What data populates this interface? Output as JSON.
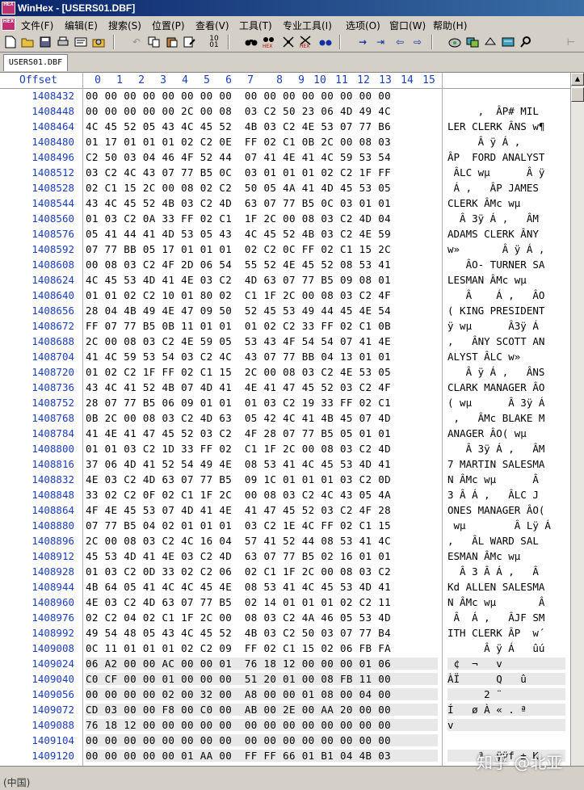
{
  "window": {
    "title": "WinHex - [USERS01.DBF]",
    "app_icon_text": "HEX"
  },
  "menu": [
    {
      "label": "文件(F)"
    },
    {
      "label": "编辑(E)"
    },
    {
      "label": "搜索(S)"
    },
    {
      "label": "位置(P)"
    },
    {
      "label": "查看(V)"
    },
    {
      "label": "工具(T)"
    },
    {
      "label": "专业工具(I)"
    },
    {
      "label": "选项(O)"
    },
    {
      "label": "窗口(W)"
    },
    {
      "label": "帮助(H)"
    }
  ],
  "toolbar": {
    "icons": [
      "new-file-icon",
      "open-folder-icon",
      "save-icon",
      "print-icon",
      "properties-icon",
      "open-disk-icon",
      "undo-icon",
      "copy-icon",
      "paste-icon",
      "write-icon",
      "clipboard-icon",
      "convert-icon",
      "binoculars-icon",
      "find-hex-icon",
      "replace-text-icon",
      "replace-hex-icon",
      "find-again-icon",
      "goto-offset-icon",
      "goto-icon",
      "back-icon",
      "forward-icon",
      "disk-icon",
      "ram-icon",
      "hash-icon",
      "calculator-icon",
      "search-tool-icon",
      "end-icon"
    ]
  },
  "tabs": [
    {
      "label": "USERS01.DBF"
    }
  ],
  "header": {
    "offset_label": "Offset",
    "columns": [
      "0",
      "1",
      "2",
      "3",
      "4",
      "5",
      "6",
      "7",
      "8",
      "9",
      "10",
      "11",
      "12",
      "13",
      "14",
      "15"
    ]
  },
  "rows": [
    {
      "offset": "1408432",
      "hex": "00 00 00 00 00 00 00 00  00 00 00 00 00 00 00 00",
      "ascii": ""
    },
    {
      "offset": "1408448",
      "hex": "00 00 00 00 00 2C 00 08  03 C2 50 23 06 4D 49 4C",
      "ascii": "     ,  ÂP# MIL"
    },
    {
      "offset": "1408464",
      "hex": "4C 45 52 05 43 4C 45 52  4B 03 C2 4E 53 07 77 B6",
      "ascii": "LER CLERK ÂNS w¶"
    },
    {
      "offset": "1408480",
      "hex": "01 17 01 01 01 02 C2 0E  FF 02 C1 0B 2C 00 08 03",
      "ascii": "     Â ÿ Á ,"
    },
    {
      "offset": "1408496",
      "hex": "C2 50 03 04 46 4F 52 44  07 41 4E 41 4C 59 53 54",
      "ascii": "ÂP  FORD ANALYST"
    },
    {
      "offset": "1408512",
      "hex": "03 C2 4C 43 07 77 B5 0C  03 01 01 01 02 C2 1F FF",
      "ascii": " ÂLC wµ      Â ÿ"
    },
    {
      "offset": "1408528",
      "hex": "02 C1 15 2C 00 08 02 C2  50 05 4A 41 4D 45 53 05",
      "ascii": " Á ,   ÂP JAMES"
    },
    {
      "offset": "1408544",
      "hex": "43 4C 45 52 4B 03 C2 4D  63 07 77 B5 0C 03 01 01",
      "ascii": "CLERK ÂMc wµ"
    },
    {
      "offset": "1408560",
      "hex": "01 03 C2 0A 33 FF 02 C1  1F 2C 00 08 03 C2 4D 04",
      "ascii": "  Â 3ÿ Á ,   ÂM"
    },
    {
      "offset": "1408576",
      "hex": "05 41 44 41 4D 53 05 43  4C 45 52 4B 03 C2 4E 59",
      "ascii": "ADAMS CLERK ÂNY"
    },
    {
      "offset": "1408592",
      "hex": "07 77 BB 05 17 01 01 01  02 C2 0C FF 02 C1 15 2C",
      "ascii": "w»       Â ÿ Á ,"
    },
    {
      "offset": "1408608",
      "hex": "00 08 03 C2 4F 2D 06 54  55 52 4E 45 52 08 53 41",
      "ascii": "   ÂO- TURNER SA"
    },
    {
      "offset": "1408624",
      "hex": "4C 45 53 4D 41 4E 03 C2  4D 63 07 77 B5 09 08 01",
      "ascii": "LESMAN ÂMc wµ"
    },
    {
      "offset": "1408640",
      "hex": "01 01 02 C2 10 01 80 02  C1 1F 2C 00 08 03 C2 4F",
      "ascii": "   Â    Á ,   ÂO"
    },
    {
      "offset": "1408656",
      "hex": "28 04 4B 49 4E 47 09 50  52 45 53 49 44 45 4E 54",
      "ascii": "( KING PRESIDENT"
    },
    {
      "offset": "1408672",
      "hex": "FF 07 77 B5 0B 11 01 01  01 02 C2 33 FF 02 C1 0B",
      "ascii": "ÿ wµ      Â3ÿ Á"
    },
    {
      "offset": "1408688",
      "hex": "2C 00 08 03 C2 4E 59 05  53 43 4F 54 54 07 41 4E",
      "ascii": ",   ÂNY SCOTT AN"
    },
    {
      "offset": "1408704",
      "hex": "41 4C 59 53 54 03 C2 4C  43 07 77 BB 04 13 01 01",
      "ascii": "ALYST ÂLC w»"
    },
    {
      "offset": "1408720",
      "hex": "01 02 C2 1F FF 02 C1 15  2C 00 08 03 C2 4E 53 05",
      "ascii": "   Â ÿ Á ,   ÂNS"
    },
    {
      "offset": "1408736",
      "hex": "43 4C 41 52 4B 07 4D 41  4E 41 47 45 52 03 C2 4F",
      "ascii": "CLARK MANAGER ÂO"
    },
    {
      "offset": "1408752",
      "hex": "28 07 77 B5 06 09 01 01  01 03 C2 19 33 FF 02 C1",
      "ascii": "( wµ      Â 3ÿ Á"
    },
    {
      "offset": "1408768",
      "hex": "0B 2C 00 08 03 C2 4D 63  05 42 4C 41 4B 45 07 4D",
      "ascii": " ,   ÂMc BLAKE M"
    },
    {
      "offset": "1408784",
      "hex": "41 4E 41 47 45 52 03 C2  4F 28 07 77 B5 05 01 01",
      "ascii": "ANAGER ÂO( wµ"
    },
    {
      "offset": "1408800",
      "hex": "01 01 03 C2 1D 33 FF 02  C1 1F 2C 00 08 03 C2 4D",
      "ascii": "   Â 3ÿ Á ,   ÂM"
    },
    {
      "offset": "1408816",
      "hex": "37 06 4D 41 52 54 49 4E  08 53 41 4C 45 53 4D 41",
      "ascii": "7 MARTIN SALESMA"
    },
    {
      "offset": "1408832",
      "hex": "4E 03 C2 4D 63 07 77 B5  09 1C 01 01 01 03 C2 0D",
      "ascii": "N ÂMc wµ      Â"
    },
    {
      "offset": "1408848",
      "hex": "33 02 C2 0F 02 C1 1F 2C  00 08 03 C2 4C 43 05 4A",
      "ascii": "3 Â Á ,   ÂLC J"
    },
    {
      "offset": "1408864",
      "hex": "4F 4E 45 53 07 4D 41 4E  41 47 45 52 03 C2 4F 28",
      "ascii": "ONES MANAGER ÂO("
    },
    {
      "offset": "1408880",
      "hex": "07 77 B5 04 02 01 01 01  03 C2 1E 4C FF 02 C1 15",
      "ascii": " wµ        Â Lÿ Á"
    },
    {
      "offset": "1408896",
      "hex": "2C 00 08 03 C2 4C 16 04  57 41 52 44 08 53 41 4C",
      "ascii": ",   ÂL WARD SAL"
    },
    {
      "offset": "1408912",
      "hex": "45 53 4D 41 4E 03 C2 4D  63 07 77 B5 02 16 01 01",
      "ascii": "ESMAN ÂMc wµ"
    },
    {
      "offset": "1408928",
      "hex": "01 03 C2 0D 33 02 C2 06  02 C1 1F 2C 00 08 03 C2",
      "ascii": "  Â 3 Â Á ,   Â"
    },
    {
      "offset": "1408944",
      "hex": "4B 64 05 41 4C 4C 45 4E  08 53 41 4C 45 53 4D 41",
      "ascii": "Kd ALLEN SALESMA"
    },
    {
      "offset": "1408960",
      "hex": "4E 03 C2 4D 63 07 77 B5  02 14 01 01 01 02 C2 11",
      "ascii": "N ÂMc wµ       Â"
    },
    {
      "offset": "1408976",
      "hex": "02 C2 04 02 C1 1F 2C 00  08 03 C2 4A 46 05 53 4D",
      "ascii": " Â  Á ,   ÂJF SM"
    },
    {
      "offset": "1408992",
      "hex": "49 54 48 05 43 4C 45 52  4B 03 C2 50 03 07 77 B4",
      "ascii": "ITH CLERK ÂP  w´"
    },
    {
      "offset": "1409008",
      "hex": "0C 11 01 01 01 02 C2 09  FF 02 C1 15 02 06 FB FA",
      "ascii": "      Â ÿ Á   ûú"
    },
    {
      "offset": "1409024",
      "hex": "06 A2 00 00 AC 00 00 01  76 18 12 00 00 00 01 06",
      "ascii": " ¢  ¬   v"
    },
    {
      "offset": "1409040",
      "hex": "C0 CF 00 00 01 00 00 00  51 20 01 00 08 FB 11 00",
      "ascii": "ÀÏ      Q   û"
    },
    {
      "offset": "1409056",
      "hex": "00 00 00 00 02 00 32 00  A8 00 00 01 08 00 04 00",
      "ascii": "      2 ¨"
    },
    {
      "offset": "1409072",
      "hex": "CD 03 00 00 F8 00 C0 00  AB 00 2E 00 AA 20 00 00",
      "ascii": "Í   ø À « . ª"
    },
    {
      "offset": "1409088",
      "hex": "76 18 12 00 00 00 00 00  00 00 00 00 00 00 00 00",
      "ascii": "v"
    },
    {
      "offset": "1409104",
      "hex": "00 00 00 00 00 00 00 00  00 00 00 00 00 00 00 00",
      "ascii": ""
    },
    {
      "offset": "1409120",
      "hex": "00 00 00 00 00 01 AA 00  FF FF 66 01 B1 04 4B 03",
      "ascii": "     ª  ÿÿf ± K"
    }
  ],
  "status": {
    "text": "(中国)"
  },
  "watermark": {
    "text": "知乎 @北亚"
  }
}
